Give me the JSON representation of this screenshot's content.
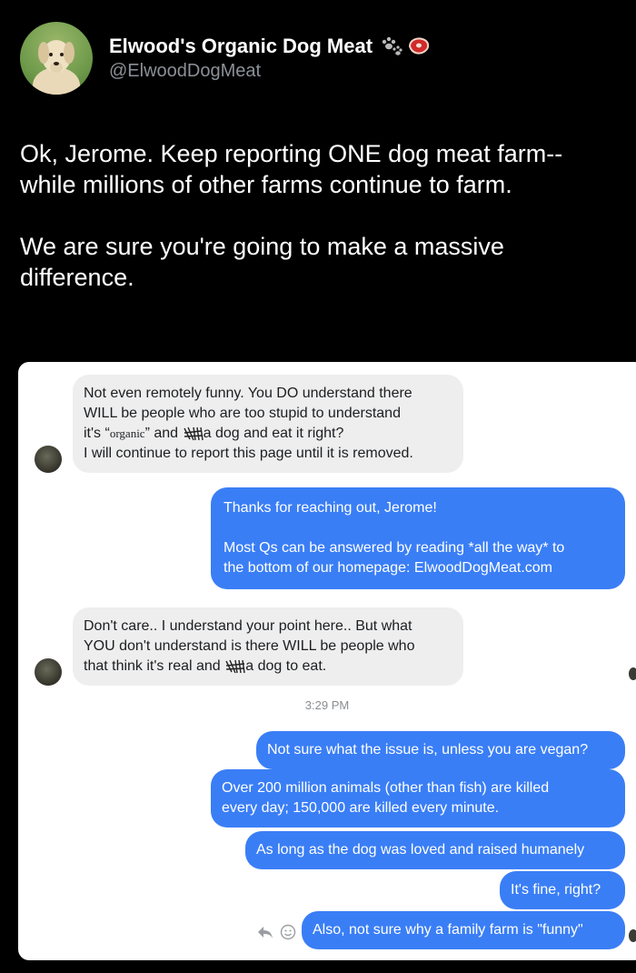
{
  "author": {
    "display_name": "Elwood's Organic Dog Meat",
    "handle": "@ElwoodDogMeat",
    "emoji_icons": [
      "paw-prints-icon",
      "steak-icon"
    ]
  },
  "tweet": {
    "text": "Ok, Jerome. Keep reporting ONE dog meat farm--\nwhile millions of other farms continue to farm.\n\nWe are sure you're going to make a massive\ndifference."
  },
  "chat": {
    "msg1": {
      "line1": "Not even remotely funny. You DO understand there",
      "line2": "WILL be people who are too stupid to understand",
      "line3_a": "it's “",
      "line3_organic": "organic",
      "line3_b": "” and ",
      "line3_struck": "kill",
      "line3_c": " a dog and eat it right?",
      "line4": "I will continue to report this page until it is removed."
    },
    "reply1": {
      "line1": "Thanks for reaching out, Jerome!",
      "line2": "Most Qs can be answered by reading *all the way* to",
      "line3": "the bottom of our homepage: ElwoodDogMeat.com"
    },
    "msg2": {
      "line1": "Don't care.. I understand your point here.. But what",
      "line2": "YOU don't understand is there WILL be people who",
      "line3_a": "that think it's real and ",
      "line3_struck": "kill",
      "line3_b": " a dog to eat."
    },
    "timestamp": "3:29 PM",
    "reply2": "Not sure what the issue is, unless you are vegan?",
    "reply3": {
      "line1": "Over 200 million animals (other than fish) are killed",
      "line2": "every day; 150,000 are killed every minute."
    },
    "reply4": "As long as the dog was loved and raised humanely",
    "reply5": "It's fine, right?",
    "reply6": "Also, not sure why a family farm is \"funny\""
  },
  "colors": {
    "background": "#000000",
    "outgoing_bubble": "#3a7ef6",
    "incoming_bubble": "#eeeeee",
    "handle_gray": "#8b9097"
  }
}
